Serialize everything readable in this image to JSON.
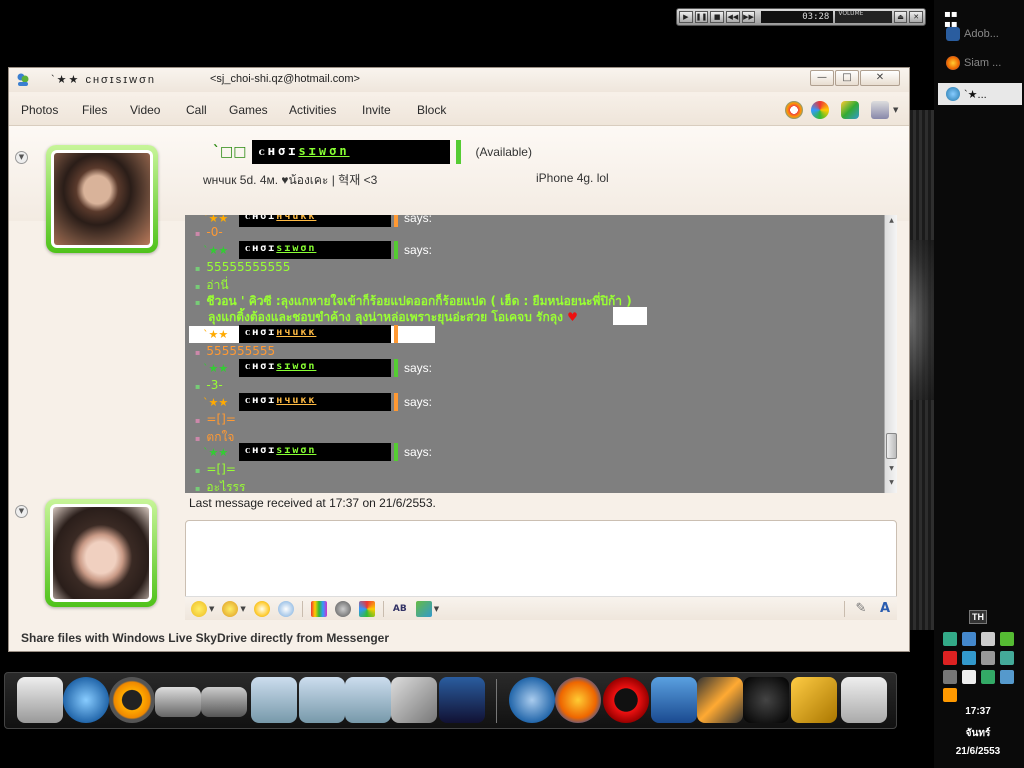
{
  "window": {
    "title": "`★★ ᴄʜσɪsɪwσn",
    "email": "<sj_choi-shi.qz@hotmail.com>",
    "minimize": "—",
    "maximize": "□",
    "close": "✕"
  },
  "media_player": {
    "time": "03:28",
    "volume_label": "VOLUME"
  },
  "menu": [
    "Photos",
    "Files",
    "Video",
    "Call",
    "Games",
    "Activities",
    "Invite",
    "Block"
  ],
  "contact": {
    "prefix": "`□□",
    "name_white": "ᴄʜσɪ",
    "name_green": "sɪwσn",
    "status": "(Available)",
    "personal_message": "wнчuк 5d. 4м. ♥น้องเคะ | 혁재 <3",
    "now_playing": "iPhone 4g.  lol"
  },
  "conversation": {
    "sender_siwon": {
      "star": "`★★",
      "white": "ᴄʜσɪ",
      "colored": "sɪwσn",
      "says": "says:"
    },
    "sender_hyuk": {
      "star": "`★★",
      "white": "ᴄʜσɪ",
      "colored": "нчuкк",
      "says": "says:"
    },
    "messages": {
      "m1": "-0-",
      "m2": "55555555555",
      "m3": "อ่านี่",
      "m4": "ชีวอน ' คิวซี :ลุงแกหายใจเข้าก็ร้อยแปดออกก็ร้อยแปด ( เฮ็ด : ยืมหน่อยนะพี่ปิก้า )",
      "m5": "ลุงแกติ้งต้องและชอบขำค้าง ลุงน่าหล่อเพราะยุนอ่ะสวย โอเคจบ รักลุง",
      "m6": "555555555",
      "m7": "-3-",
      "m8": "=[]=",
      "m9": "ตกใจ",
      "m10": "=[]=",
      "m11": "อะไรรร"
    },
    "heart": "♥"
  },
  "last_message": "Last message received at 17:37 on 21/6/2553.",
  "footer": "Share files with Windows Live SkyDrive directly from Messenger",
  "taskbar": {
    "items": [
      {
        "label": "Adob..."
      },
      {
        "label": "Siam ..."
      },
      {
        "label": "`★..."
      }
    ],
    "lang": "TH",
    "time": "17:37",
    "day": "จันทร์",
    "date": "21/6/2553"
  },
  "colors": {
    "siwon_accent": "#55cc33",
    "hyuk_accent": "#ff9933",
    "conversation_bg": "#7f7f7f",
    "window_bg": "#f7f0e8"
  }
}
